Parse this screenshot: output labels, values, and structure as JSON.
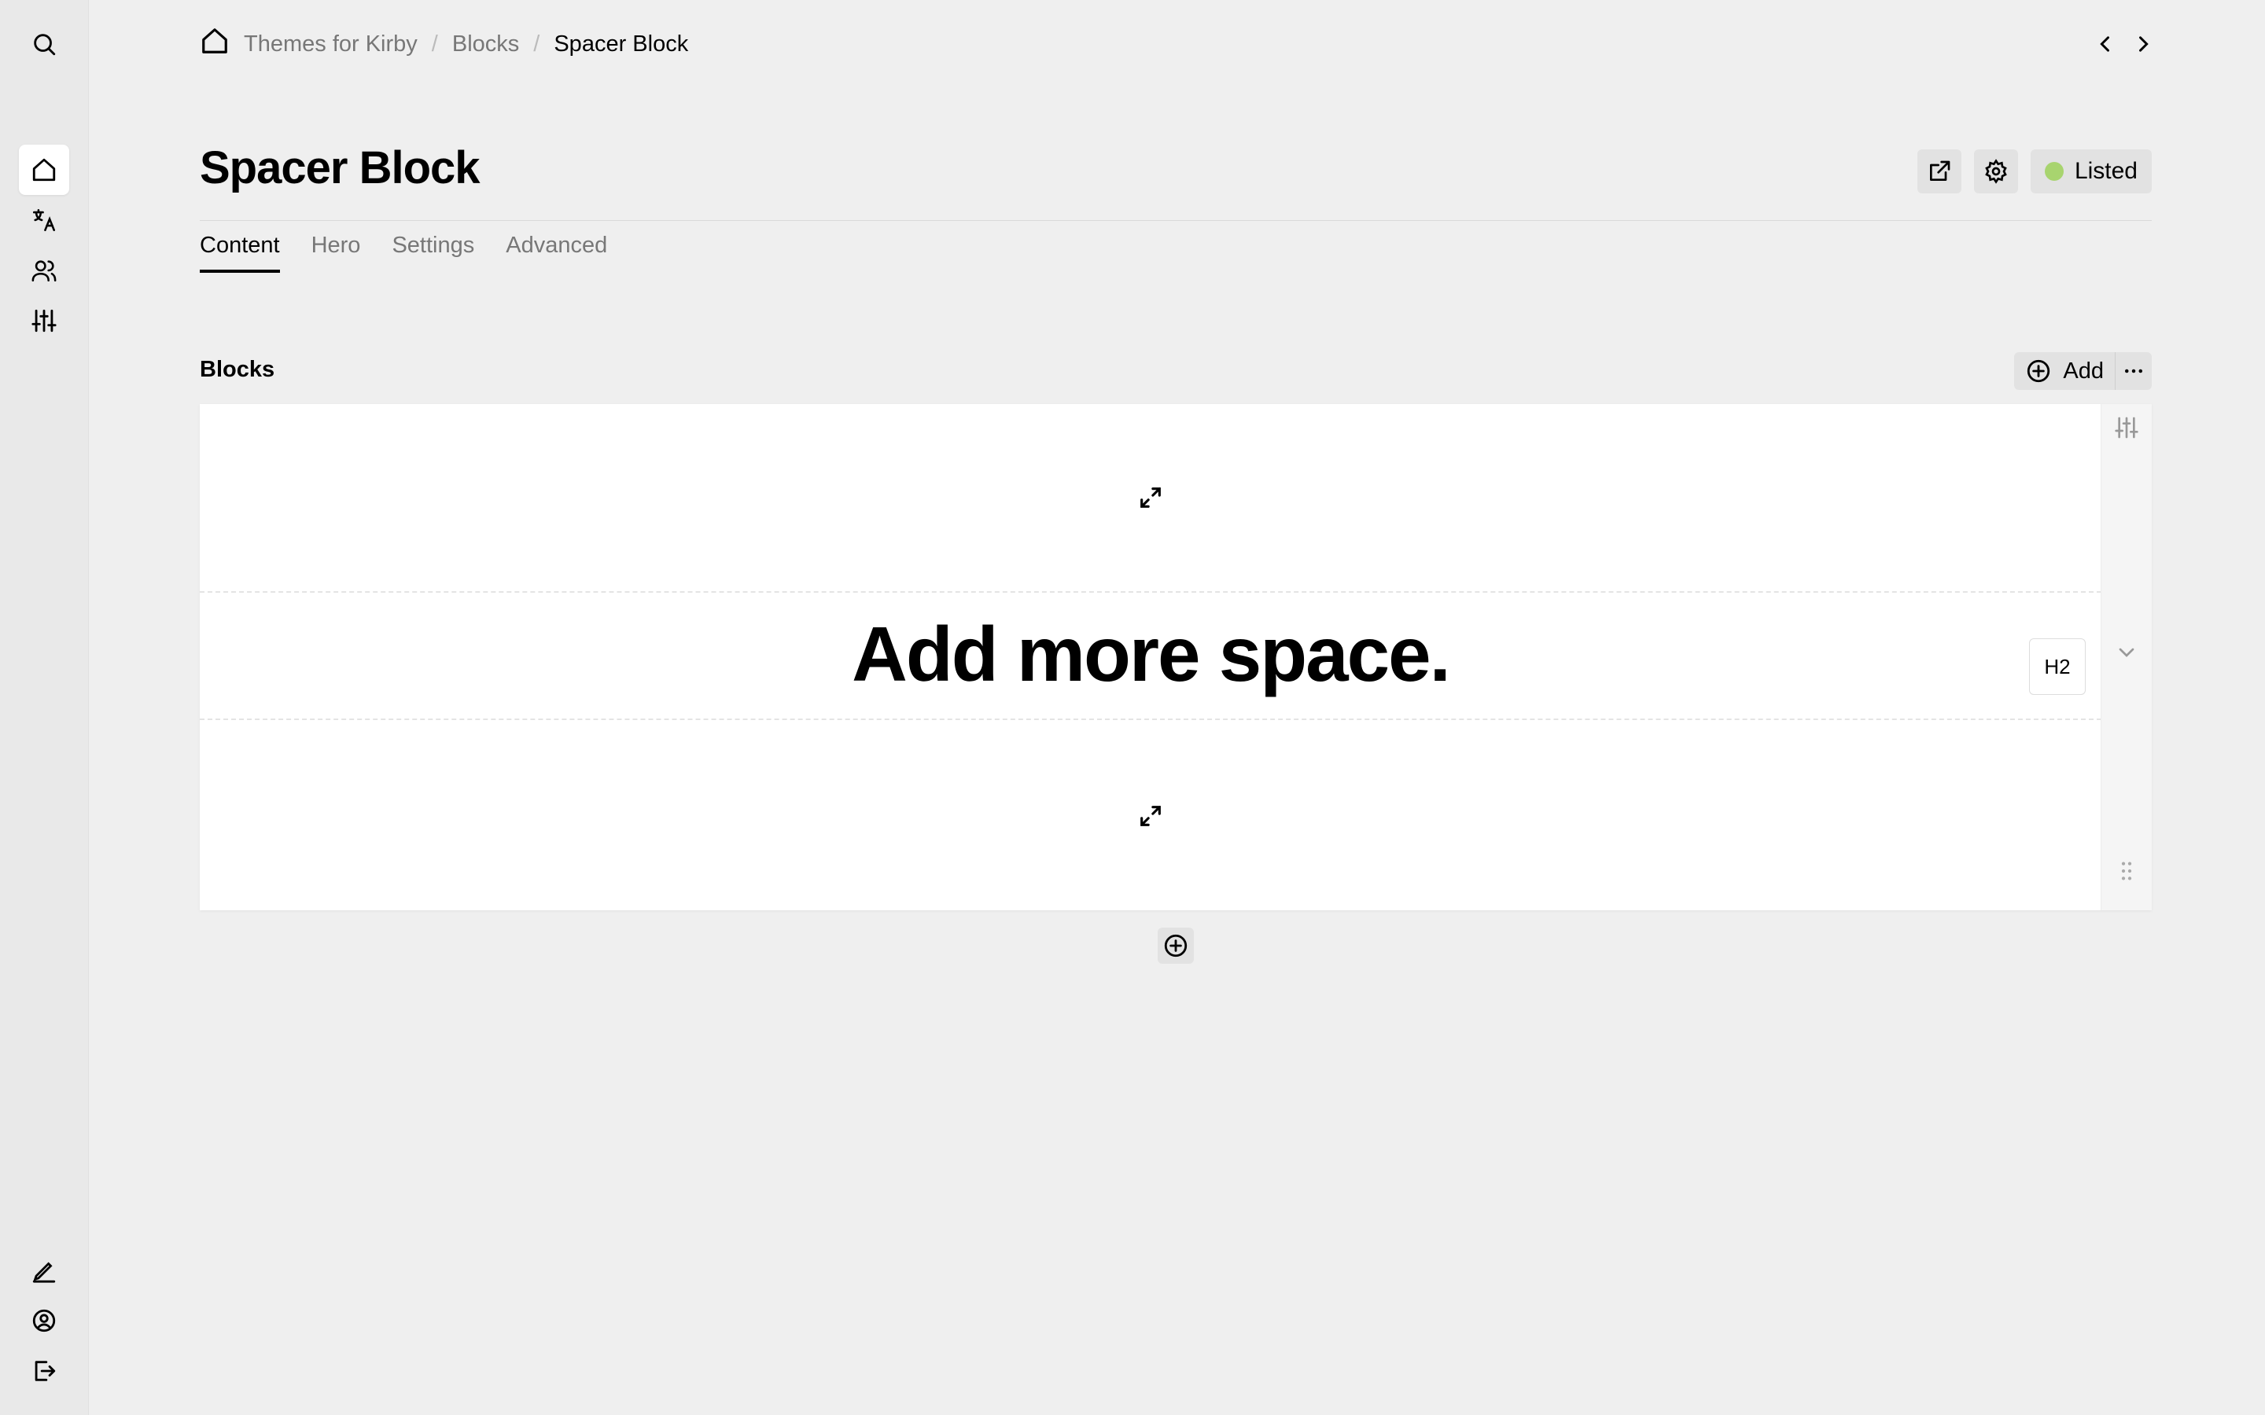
{
  "breadcrumb": {
    "home_icon": "home-icon",
    "items": [
      {
        "label": "Themes for Kirby"
      },
      {
        "label": "Blocks"
      },
      {
        "label": "Spacer Block"
      }
    ],
    "separator": "/"
  },
  "page": {
    "title": "Spacer Block",
    "status_label": "Listed",
    "status_color": "#a8d46f"
  },
  "tabs": [
    {
      "label": "Content",
      "active": true
    },
    {
      "label": "Hero"
    },
    {
      "label": "Settings"
    },
    {
      "label": "Advanced"
    }
  ],
  "blocks_section": {
    "label": "Blocks",
    "add_label": "Add"
  },
  "heading_block": {
    "text": "Add more space.",
    "level": "H2"
  },
  "icons": {
    "sidebar_top": [
      "search-icon"
    ],
    "sidebar_menu": [
      "home-icon",
      "languages-icon",
      "users-icon",
      "settings-sliders-icon"
    ],
    "sidebar_bottom": [
      "edit-icon",
      "account-icon",
      "logout-icon"
    ]
  }
}
